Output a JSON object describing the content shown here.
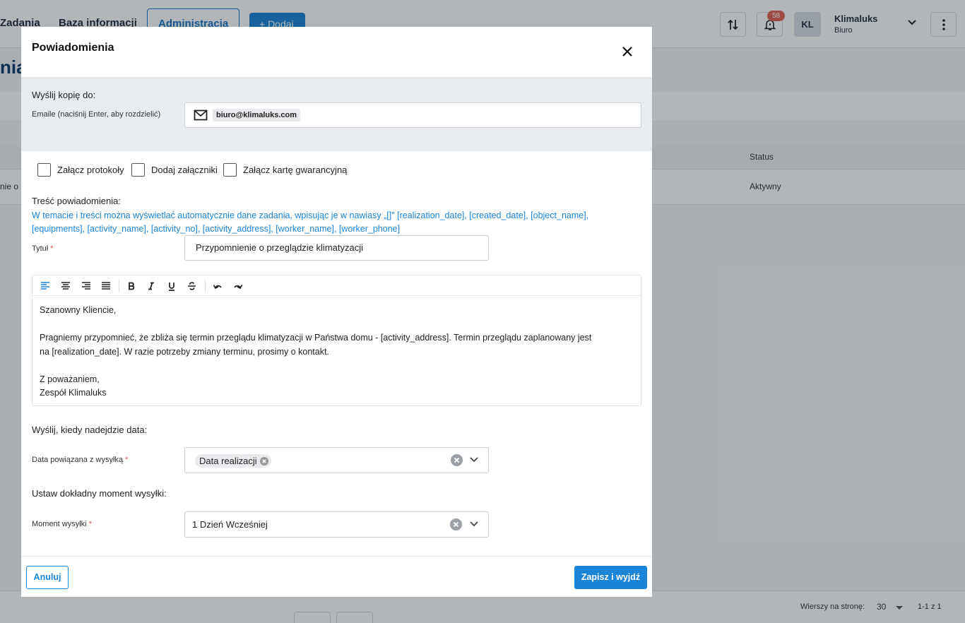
{
  "nav": {
    "zadania": "Zadania",
    "baza": "Baza informacji",
    "administracja": "Administracja",
    "dodaj": "+ Dodaj"
  },
  "header": {
    "notification_count": "58",
    "avatar_initials": "KL",
    "user_name": "Klimaluks",
    "user_role": "Biuro"
  },
  "background": {
    "page_title_fragment": "nia",
    "table_status_header": "Status",
    "row_name_fragment": "nie o z",
    "row_status": "Aktywny",
    "rows_per_page_label": "Wierszy na stronę:",
    "rows_per_page_value": "30",
    "page_range": "1-1 z 1"
  },
  "modal": {
    "title": "Powiadomienia",
    "copy_label": "Wyślij kopię do:",
    "emails_label": "Emaile (naciśnij Enter, aby rozdzielić)",
    "email_chip": "biuro@klimaluks.com",
    "checkboxes": {
      "protokoly": "Załącz protokoły",
      "zalaczniki": "Dodaj załączniki",
      "karta": "Załącz kartę gwarancyjną"
    },
    "tresc_label": "Treść powiadomienia:",
    "hint": "W temacie i treści można wyświetlać automatycznie dane zadania, wpisując je w nawiasy „[]\" [realization_date], [created_date], [object_name], [equipments], [activity_name], [activity_no], [activity_address], [worker_name], [worker_phone]",
    "title_field": {
      "label": "Tytuł",
      "required": "*",
      "value": "Przypomnienie o przeglądzie klimatyzacji"
    },
    "editor": {
      "greeting": "Szanowny Kliencie,",
      "body_line1": "Pragniemy przypomnieć, że zbliża się termin przeglądu klimatyzacji w Państwa domu - [activity_address]. Termin przeglądu zaplanowany jest",
      "body_line2": "na [realization_date]. W razie potrzeby zmiany terminu, prosimy o kontakt.",
      "closing": "Z poważaniem,",
      "signature": "Zespół Klimaluks"
    },
    "send_when_label": "Wyślij, kiedy nadejdzie data:",
    "date_field": {
      "label": "Data powiązana z wysyłką",
      "required": "*",
      "chip": "Data realizacji"
    },
    "exact_moment_label": "Ustaw dokładny moment wysyłki:",
    "moment_field": {
      "label": "Moment wysyłki",
      "required": "*",
      "value": "1 Dzień Wcześniej"
    },
    "cancel_label": "Anuluj",
    "save_label": "Zapisz i wyjdź"
  },
  "colors": {
    "primary": "#1a84d8",
    "hint_text": "#1a84d8",
    "required": "#d9534f",
    "badge": "#e06055"
  }
}
